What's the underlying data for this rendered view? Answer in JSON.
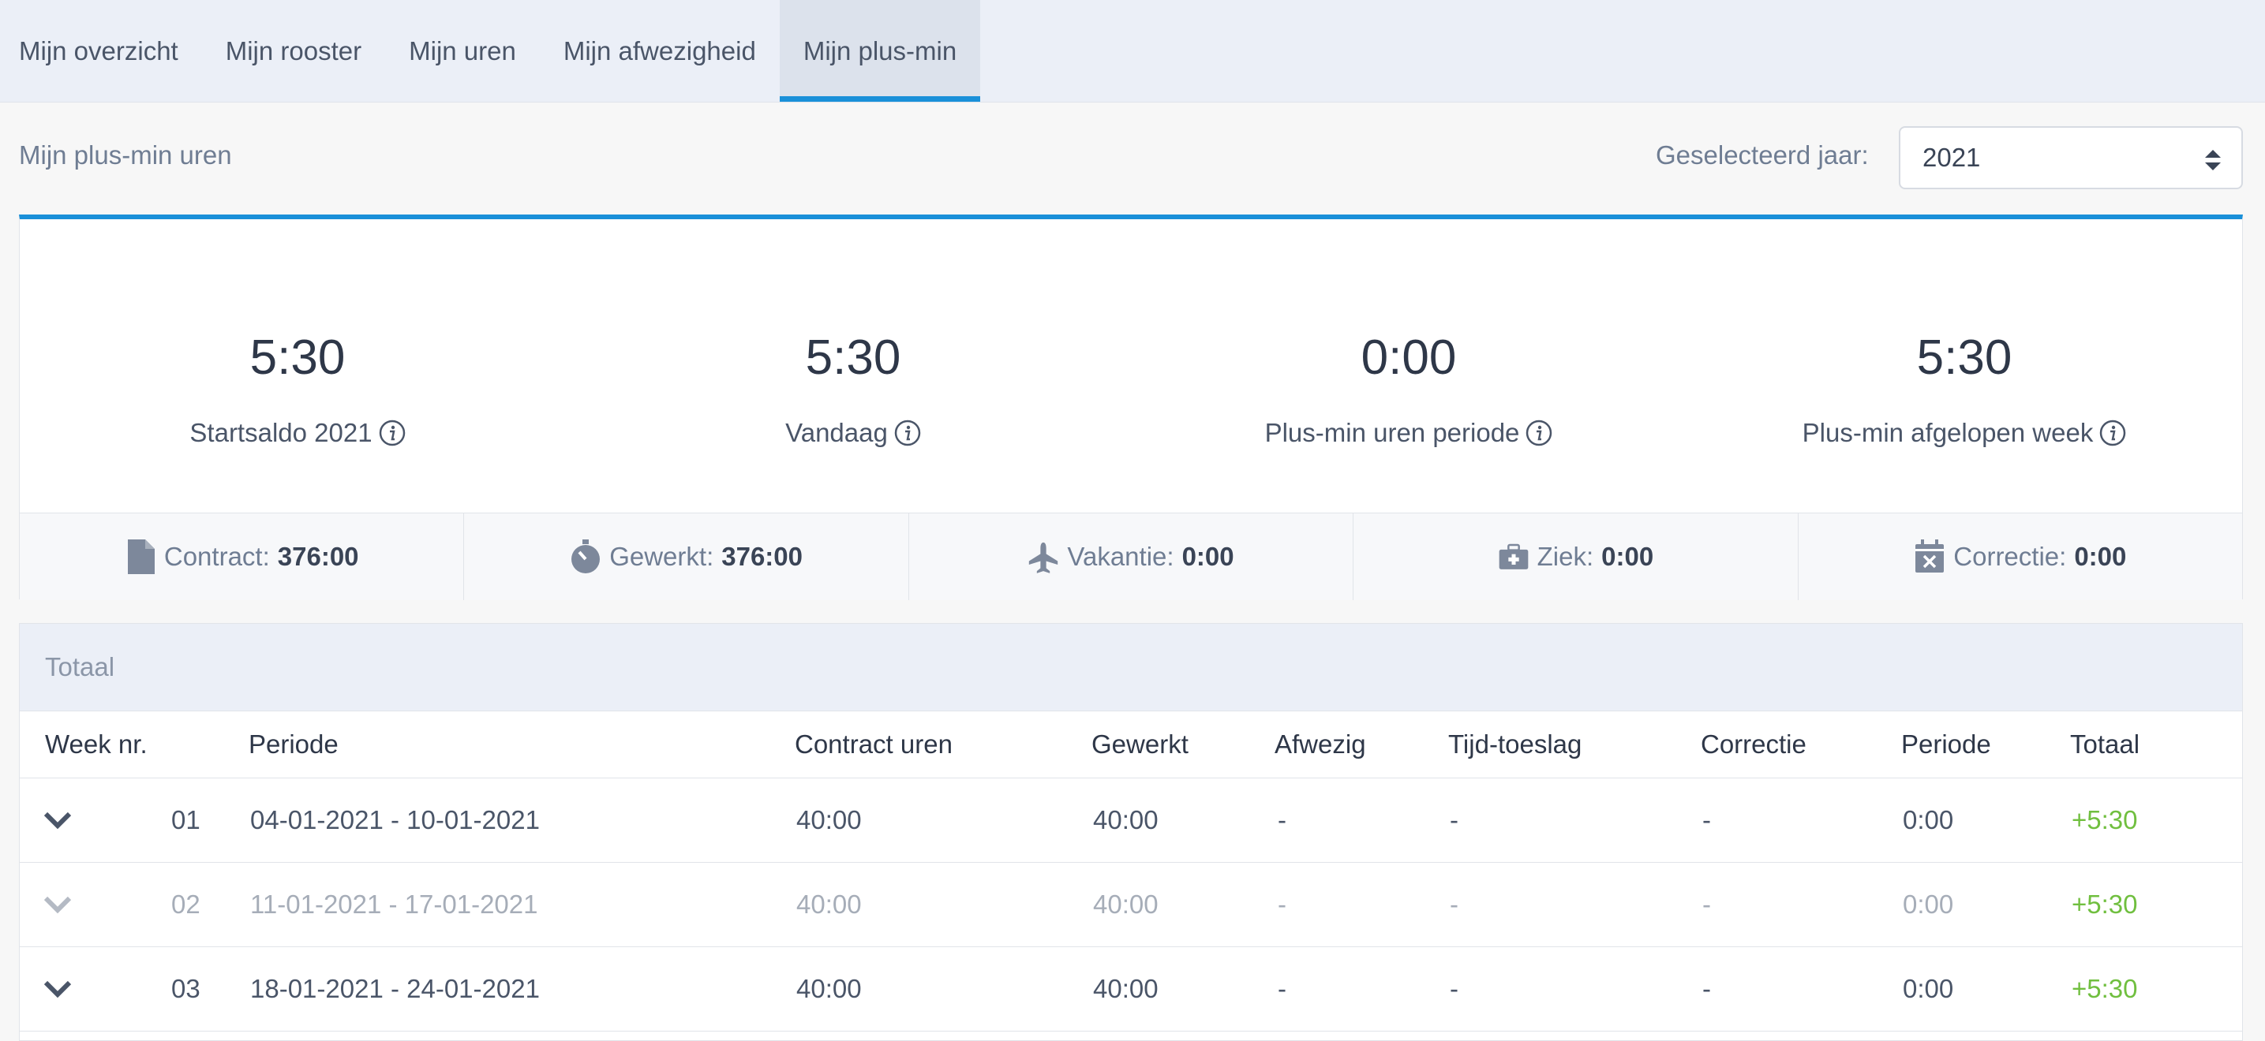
{
  "nav": {
    "tabs": [
      {
        "label": "Mijn overzicht"
      },
      {
        "label": "Mijn rooster"
      },
      {
        "label": "Mijn uren"
      },
      {
        "label": "Mijn afwezigheid"
      },
      {
        "label": "Mijn plus-min",
        "active": true
      }
    ]
  },
  "header": {
    "title": "Mijn plus-min uren",
    "year_label": "Geselecteerd jaar:",
    "year_value": "2021"
  },
  "summary": {
    "kpis": [
      {
        "value": "5:30",
        "label": "Startsaldo 2021"
      },
      {
        "value": "5:30",
        "label": "Vandaag"
      },
      {
        "value": "0:00",
        "label": "Plus-min uren periode"
      },
      {
        "value": "5:30",
        "label": "Plus-min afgelopen week"
      }
    ],
    "stats": [
      {
        "icon": "document-icon",
        "label": "Contract:",
        "value": "376:00"
      },
      {
        "icon": "stopwatch-icon",
        "label": "Gewerkt:",
        "value": "376:00"
      },
      {
        "icon": "airplane-icon",
        "label": "Vakantie:",
        "value": "0:00"
      },
      {
        "icon": "medical-kit-icon",
        "label": "Ziek:",
        "value": "0:00"
      },
      {
        "icon": "calendar-x-icon",
        "label": "Correctie:",
        "value": "0:00"
      }
    ]
  },
  "table": {
    "title": "Totaal",
    "columns": [
      "Week nr.",
      "Periode",
      "Contract uren",
      "Gewerkt",
      "Afwezig",
      "Tijd-toeslag",
      "Correctie",
      "Periode",
      "Totaal"
    ],
    "rows": [
      {
        "week": "01",
        "period": "04-01-2021 - 10-01-2021",
        "contract": "40:00",
        "worked": "40:00",
        "absent": "-",
        "surcharge": "-",
        "correction": "-",
        "period_val": "0:00",
        "total": "+5:30"
      },
      {
        "week": "02",
        "period": "11-01-2021 - 17-01-2021",
        "contract": "40:00",
        "worked": "40:00",
        "absent": "-",
        "surcharge": "-",
        "correction": "-",
        "period_val": "0:00",
        "total": "+5:30"
      },
      {
        "week": "03",
        "period": "18-01-2021 - 24-01-2021",
        "contract": "40:00",
        "worked": "40:00",
        "absent": "-",
        "surcharge": "-",
        "correction": "-",
        "period_val": "0:00",
        "total": "+5:30"
      }
    ]
  },
  "colors": {
    "accent": "#1a90d9",
    "positive": "#70bf3f"
  }
}
